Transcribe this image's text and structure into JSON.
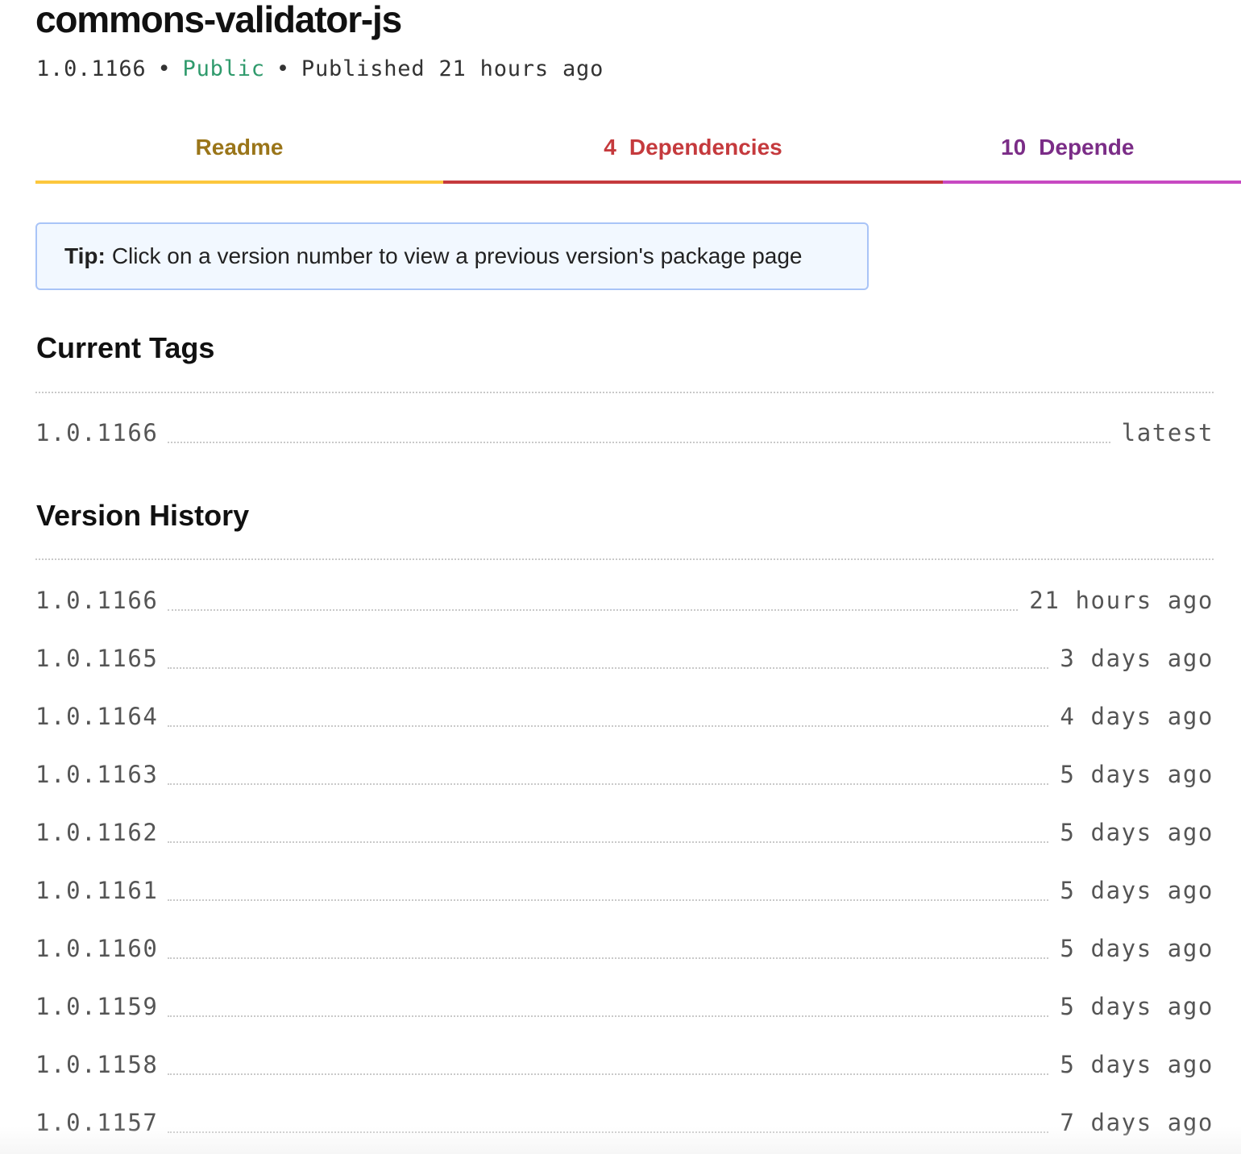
{
  "package": {
    "name": "commons-validator-js",
    "version": "1.0.1166",
    "visibility": "Public",
    "published": "Published 21 hours ago",
    "separator": "•"
  },
  "tabs": [
    {
      "label": "Readme",
      "count": "",
      "color": "#9a7519",
      "underline": "#fcc73d"
    },
    {
      "label": "Dependencies",
      "count": "4",
      "color": "#c53a3d",
      "underline": "#c53a3d"
    },
    {
      "label": "Depende",
      "count": "10",
      "color": "#7b2d87",
      "underline": "#c749c2"
    }
  ],
  "tip": {
    "label": "Tip:",
    "text": "Click on a version number to view a previous version's package page"
  },
  "current_tags": {
    "title": "Current Tags",
    "rows": [
      {
        "version": "1.0.1166",
        "tag": "latest"
      }
    ]
  },
  "version_history": {
    "title": "Version History",
    "rows": [
      {
        "version": "1.0.1166",
        "age": "21 hours ago"
      },
      {
        "version": "1.0.1165",
        "age": "3 days ago"
      },
      {
        "version": "1.0.1164",
        "age": "4 days ago"
      },
      {
        "version": "1.0.1163",
        "age": "5 days ago"
      },
      {
        "version": "1.0.1162",
        "age": "5 days ago"
      },
      {
        "version": "1.0.1161",
        "age": "5 days ago"
      },
      {
        "version": "1.0.1160",
        "age": "5 days ago"
      },
      {
        "version": "1.0.1159",
        "age": "5 days ago"
      },
      {
        "version": "1.0.1158",
        "age": "5 days ago"
      },
      {
        "version": "1.0.1157",
        "age": "7 days ago"
      }
    ]
  }
}
